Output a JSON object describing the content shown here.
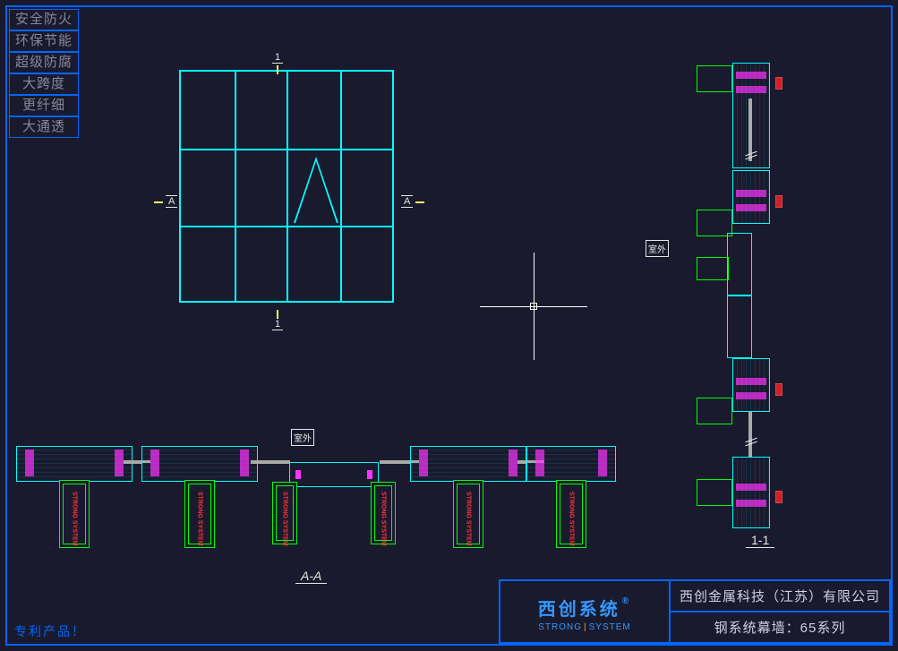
{
  "attributes": [
    "安全防火",
    "环保节能",
    "超级防腐",
    "大跨度",
    "更纤细",
    "大通透"
  ],
  "patent_label": "专利产品！",
  "title_block": {
    "brand_name": "西创系统",
    "brand_reg": "®",
    "brand_sub_left": "STRONG",
    "brand_sub_right": "SYSTEM",
    "company": "西创金属科技（江苏）有限公司",
    "product": "钢系统幕墙：65系列"
  },
  "labels": {
    "outdoor": "室外",
    "section_AA": "A-A",
    "section_11": "1-1",
    "mark_A": "A",
    "mark_1": "1",
    "mullion_brand": "STRONG SYSTEM"
  },
  "chart_data": {
    "type": "diagram",
    "description": "CAD architectural drawing: curtain wall system series 65",
    "views": [
      {
        "name": "elevation",
        "grid_cols": 4,
        "grid_rows": 3,
        "operable_panel": {
          "col": 3,
          "row": 2,
          "symbol": "top-hung"
        }
      },
      {
        "name": "section_A-A",
        "orientation": "horizontal",
        "mullion_count": 5,
        "has_opening_center": true
      },
      {
        "name": "section_1-1",
        "orientation": "vertical",
        "transom_count": 4,
        "has_opening_center": true
      }
    ],
    "colors": {
      "profile": "#00ffff",
      "mullion": "#00ff00",
      "gasket": "#ff33ff",
      "thermal": "#ff2222",
      "glass": "#aaaaaa",
      "border": "#0066ff"
    }
  }
}
